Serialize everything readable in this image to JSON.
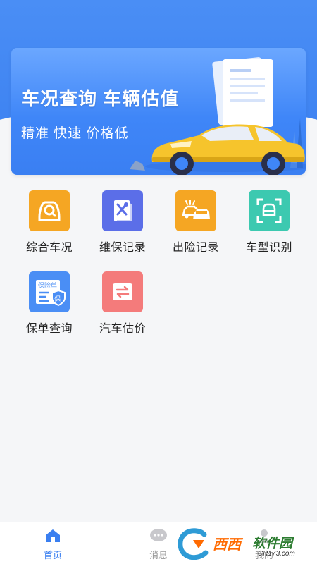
{
  "banner": {
    "title": "车况查询 车辆估值",
    "subtitle": "精准 快速 价格低"
  },
  "services": [
    {
      "label": "综合车况",
      "icon": "car-search-icon",
      "color": "#f5a623"
    },
    {
      "label": "维保记录",
      "icon": "maintenance-tools-icon",
      "color": "#5b6ee8"
    },
    {
      "label": "出险记录",
      "icon": "car-accident-icon",
      "color": "#f5a623"
    },
    {
      "label": "车型识别",
      "icon": "car-scan-icon",
      "color": "#3cc9b0"
    },
    {
      "label": "保单查询",
      "icon": "insurance-policy-icon",
      "color": "#4a8ef5",
      "doc_title": "保险单",
      "badge": "保"
    },
    {
      "label": "汽车估价",
      "icon": "price-exchange-icon",
      "color": "#f47b7b"
    }
  ],
  "tabbar": {
    "items": [
      {
        "label": "首页",
        "icon": "home-icon",
        "active": true
      },
      {
        "label": "消息",
        "icon": "message-icon",
        "active": false
      },
      {
        "label": "我的",
        "icon": "user-icon",
        "active": false
      }
    ]
  },
  "watermark": {
    "brand": "西西",
    "name": "软件园",
    "url": "CR173.com"
  },
  "colors": {
    "primary": "#3a7ff0",
    "background": "#f5f6f8"
  }
}
